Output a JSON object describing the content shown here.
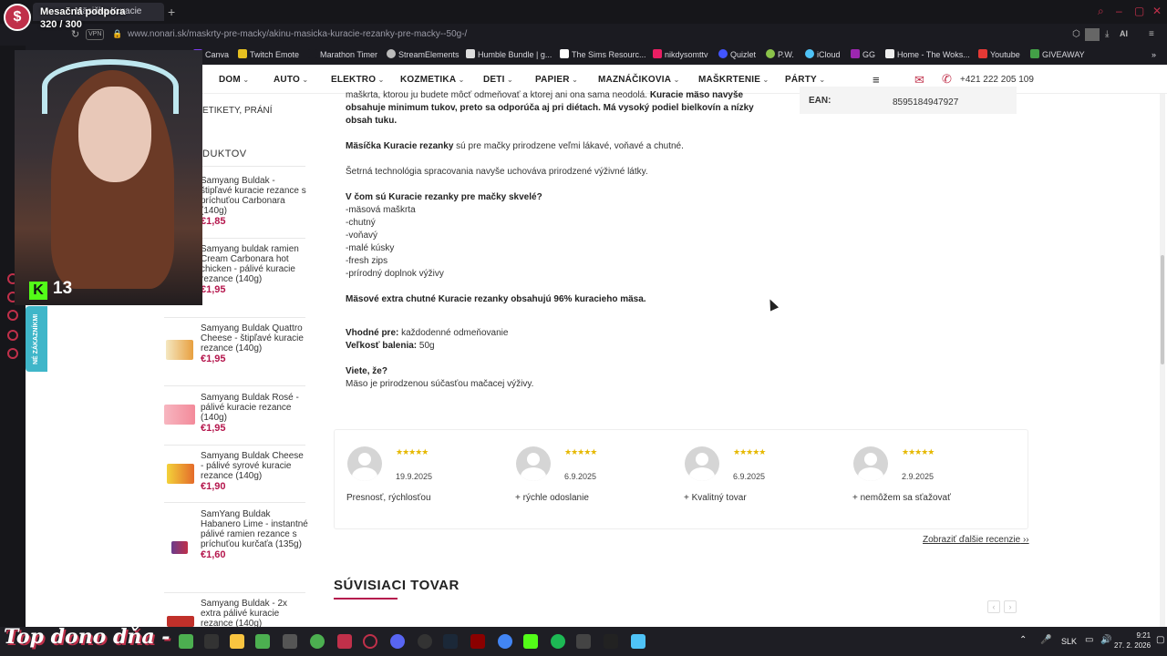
{
  "browser": {
    "tab_title": "Mäsička Kuracie",
    "url": "www.nonari.sk/maskrty-pre-macky/akinu-masicka-kuracie-rezanky-pre-macky--50g-/",
    "vpn_label": "VPN",
    "bookmarks": [
      "Canva",
      "Twitch Emote",
      "Marathon Timer",
      "StreamElements",
      "Humble Bundle | g...",
      "The Sims Resourc...",
      "nikdysomttv",
      "Quizlet",
      "P.W.",
      "iCloud",
      "GG",
      "Home - The Woks...",
      "Youtube",
      "GIVEAWAY"
    ]
  },
  "stream_overlay": {
    "support_title": "Mesačná podpora",
    "support_count": "320 / 300",
    "kick_count": "13",
    "bottom_caption": "Top dono dňa -",
    "side_tab": "NÉ ZÁKAZNÍKMI"
  },
  "nav": {
    "items": [
      "DOM",
      "AUTO",
      "ELEKTRO",
      "KOZMETIKA",
      "DETI",
      "PAPIER",
      "MAZNÁČIKOVIA",
      "MAŠKRTENIE",
      "PÁRTY"
    ],
    "phone": "+421 222 205 109"
  },
  "left_column": {
    "filter_label": "ETIKETY, PRÁNÍ",
    "section_label": "DUKTOV",
    "products": [
      {
        "name": "Samyang Buldak - štipľavé kuracie rezance s príchuťou Carbonara (140g)",
        "price": "€1,85"
      },
      {
        "name": "Samyang buldak ramien Cream Carbonara hot chicken - pálivé kuracie rezance (140g)",
        "price": "€1,95"
      },
      {
        "name": "Samyang Buldak Quattro Cheese - štipľavé kuracie rezance (140g)",
        "price": "€1,95"
      },
      {
        "name": "Samyang Buldak Rosé - pálivé kuracie rezance (140g)",
        "price": "€1,95"
      },
      {
        "name": "Samyang Buldak Cheese - pálivé syrové kuracie rezance (140g)",
        "price": "€1,90"
      },
      {
        "name": "SamYang Buldak Habanero Lime - instantné pálivé ramien rezance s príchuťou kurčaťa (135g)",
        "price": "€1,60"
      },
      {
        "name": "Samyang Buldak - 2x extra pálivé kuracie rezance (140g)",
        "price": ""
      }
    ]
  },
  "content": {
    "intro_l1a": "maškrta, ktorou ju budete môcť odmeňovať a ktorej ani ona sama neodolá.",
    "intro_l1b": "Kuracie mäso navyše",
    "intro_l2": "obsahuje minimum tukov, preto sa odporúča aj pri diétach. Má vysoký podiel bielkovín a nízky",
    "intro_l3": "obsah tuku.",
    "p1_bold": "Mäsíčka Kuracie rezanky",
    "p1_rest": " sú pre mačky prirodzene veľmi lákavé, voňavé a chutné.",
    "p2": "Šetrná technológia spracovania navyše uchováva prirodzené výživné látky.",
    "list_title": "V čom sú Kuracie rezanky pre mačky skvelé?",
    "list": [
      "-mäsová maškrta",
      "-chutný",
      "-voňavý",
      "-malé kúsky",
      "-fresh zips",
      "-prírodný doplnok výživy"
    ],
    "p3": "Mäsové extra chutné Kuracie rezanky obsahujú 96% kuracieho mäsa.",
    "suitable_label": "Vhodné pre:",
    "suitable_value": " každodenné odmeňovanie",
    "size_label": "Veľkosť balenia:",
    "size_value": " 50g",
    "did_you_know": "Viete, že?",
    "fact": "Mäso je prirodzenou súčasťou mačacej výživy.",
    "ean_label": "EAN:",
    "ean_value": "8595184947927"
  },
  "reviews": [
    {
      "stars": "★★★★★",
      "rating": 5,
      "date": "19.9.2025",
      "text": "Presnosť, rýchlosťou"
    },
    {
      "stars": "★★★★★",
      "rating": 5,
      "date": "6.9.2025",
      "text": "+ rýchle odoslanie"
    },
    {
      "stars": "★★★★★",
      "rating": 5,
      "date": "6.9.2025",
      "text": "+ Kvalitný tovar"
    },
    {
      "stars": "★★★★★",
      "rating": 5,
      "date": "2.9.2025",
      "text": "+ nemôžem sa sťažovať"
    }
  ],
  "more_reviews": "Zobraziť ďalšie recenzie",
  "related_title": "SÚVISIACI TOVAR",
  "taskbar": {
    "lang": "SLK",
    "time": "9:21",
    "date": "27. 2. 2026"
  },
  "colors": {
    "accent": "#b5174d",
    "opera_red": "#c0304a",
    "kick_green": "#53fc18",
    "star": "#e6b800"
  }
}
